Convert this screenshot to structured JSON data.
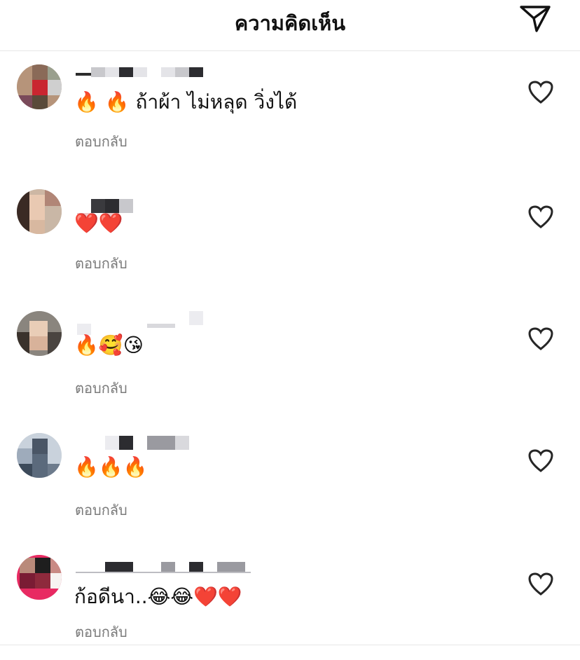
{
  "header": {
    "title": "ความคิดเห็น",
    "send_icon": "paper-plane-icon"
  },
  "comments": [
    {
      "username": "",
      "text": "🔥 🔥 ถ้าผ้า ไม่หลุด วิ่งได้",
      "reply_label": "ตอบกลับ",
      "like_icon": "heart-outline-icon"
    },
    {
      "username": "",
      "text": "❤️❤️",
      "reply_label": "ตอบกลับ",
      "like_icon": "heart-outline-icon"
    },
    {
      "username": "",
      "text": "🔥🥰😘",
      "reply_label": "ตอบกลับ",
      "like_icon": "heart-outline-icon"
    },
    {
      "username": "",
      "text": "🔥🔥🔥",
      "reply_label": "ตอบกลับ",
      "like_icon": "heart-outline-icon"
    },
    {
      "username": "",
      "text": "ก้อดีนา..😂😂❤️❤️",
      "reply_label": "ตอบกลับ",
      "like_icon": "heart-outline-icon"
    }
  ],
  "colors": {
    "text": "#111111",
    "secondary": "#7a7a7a",
    "divider": "#e6e6e6"
  }
}
